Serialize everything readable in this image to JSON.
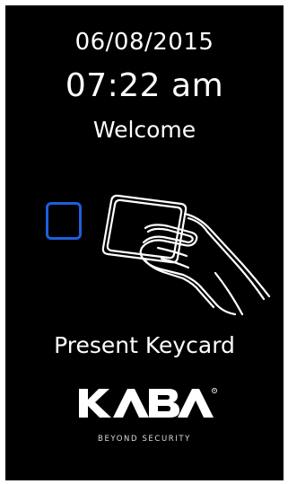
{
  "screen": {
    "date": "06/08/2015",
    "time": "07:22 am",
    "greeting": "Welcome",
    "prompt": "Present Keycard"
  },
  "brand": {
    "logo_text": "KABA",
    "tagline": "BEYOND SECURITY"
  },
  "icons": {
    "reader": "card-reader-icon",
    "hand": "hand-holding-card-icon"
  },
  "colors": {
    "background": "#000000",
    "text": "#ffffff",
    "reader_accent": "#1e5fe0"
  }
}
